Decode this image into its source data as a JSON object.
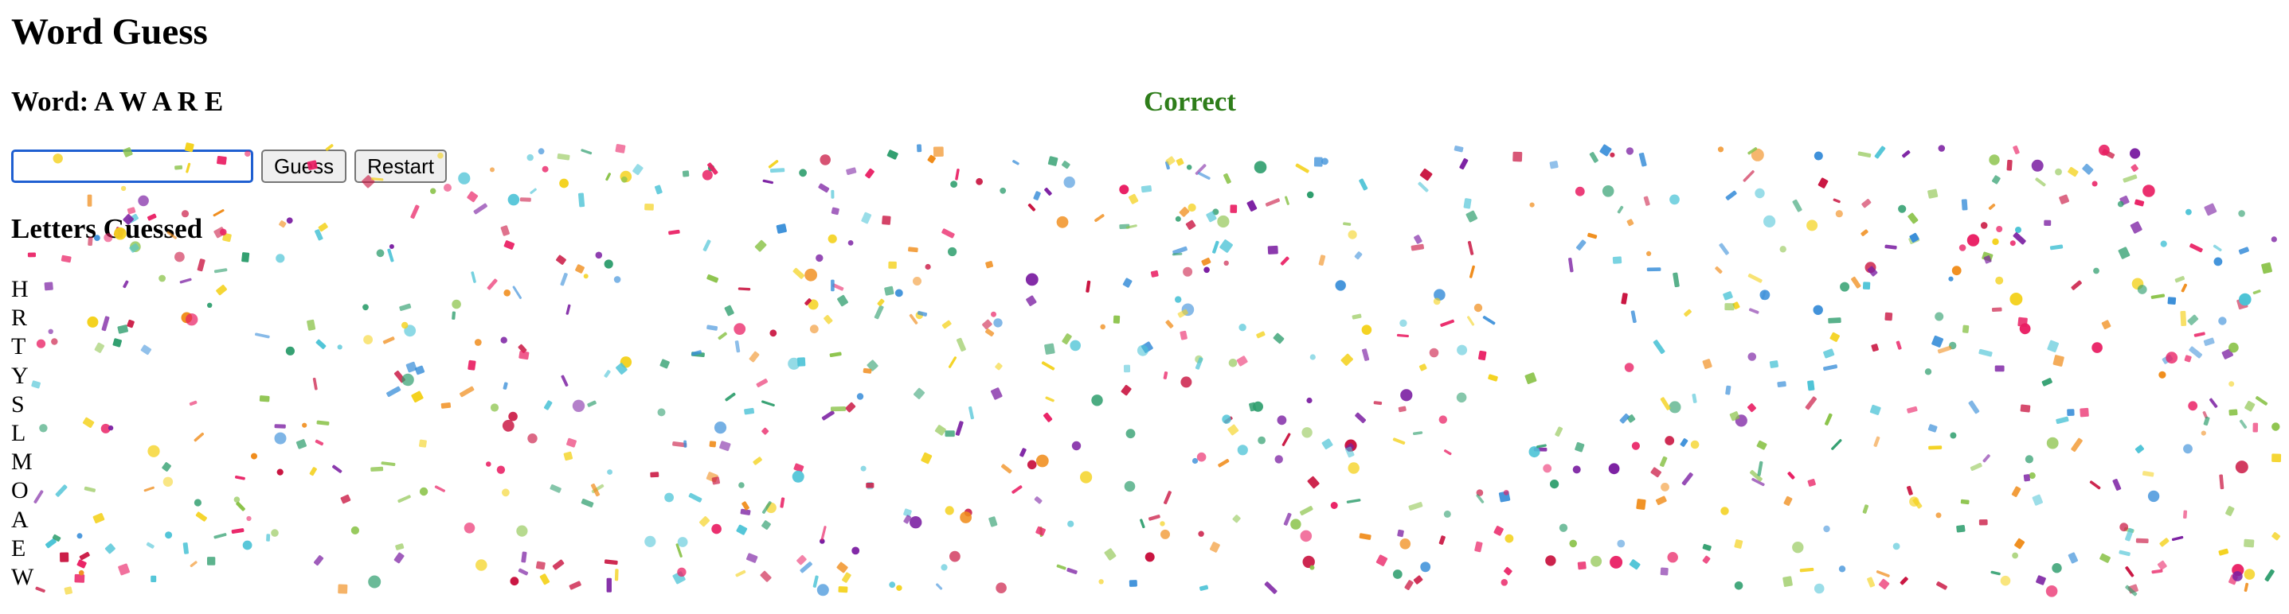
{
  "app": {
    "title": "Word Guess",
    "word_line": "Word: A W A R E",
    "status": "Correct",
    "status_color": "#2e7d1a"
  },
  "controls": {
    "input_value": "",
    "guess_label": "Guess",
    "restart_label": "Restart"
  },
  "guessed": {
    "title": "Letters Guessed",
    "letters": [
      "H",
      "R",
      "T",
      "Y",
      "S",
      "L",
      "M",
      "O",
      "A",
      "E",
      "W"
    ]
  },
  "confetti": {
    "visible": true,
    "colors": [
      "#c8103d",
      "#7b1fa2",
      "#f4d21f",
      "#2f9e6e",
      "#3b8fd9",
      "#f08c1a",
      "#4cc3d6",
      "#8bc34a",
      "#e91e63"
    ]
  }
}
